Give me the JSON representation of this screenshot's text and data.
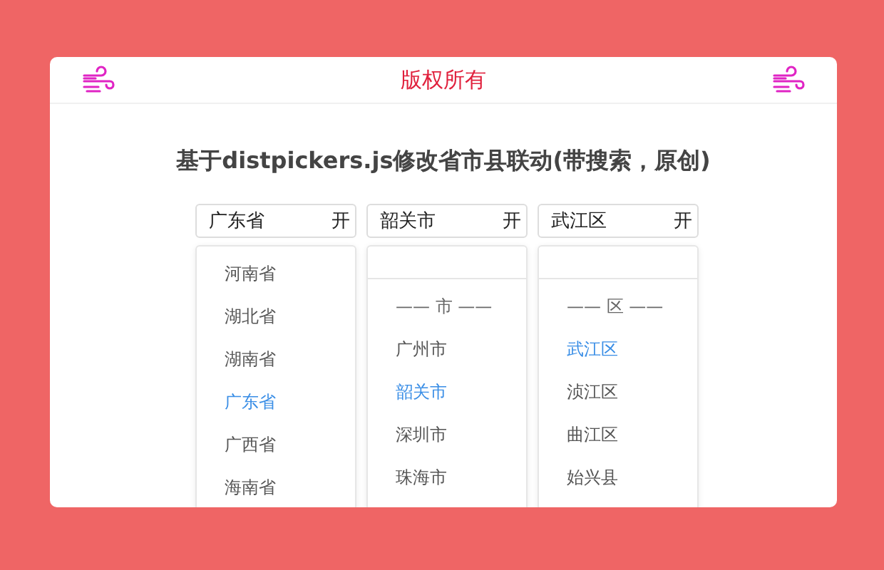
{
  "header": {
    "title": "版权所有"
  },
  "heading": "基于distpickers.js修改省市县联动(带搜索，原创)",
  "pickers": [
    {
      "value": "广东省",
      "toggle": "开",
      "search_field": false,
      "options": [
        {
          "label": "河南省",
          "selected": false
        },
        {
          "label": "湖北省",
          "selected": false
        },
        {
          "label": "湖南省",
          "selected": false
        },
        {
          "label": "广东省",
          "selected": true
        },
        {
          "label": "广西省",
          "selected": false
        },
        {
          "label": "海南省",
          "selected": false
        }
      ]
    },
    {
      "value": "韶关市",
      "toggle": "开",
      "search_field": true,
      "group": "—— 市 ——",
      "options": [
        {
          "label": "广州市",
          "selected": false
        },
        {
          "label": "韶关市",
          "selected": true
        },
        {
          "label": "深圳市",
          "selected": false
        },
        {
          "label": "珠海市",
          "selected": false
        }
      ]
    },
    {
      "value": "武江区",
      "toggle": "开",
      "search_field": true,
      "group": "—— 区 ——",
      "options": [
        {
          "label": "武江区",
          "selected": true
        },
        {
          "label": "浈江区",
          "selected": false
        },
        {
          "label": "曲江区",
          "selected": false
        },
        {
          "label": "始兴县",
          "selected": false
        }
      ]
    }
  ]
}
